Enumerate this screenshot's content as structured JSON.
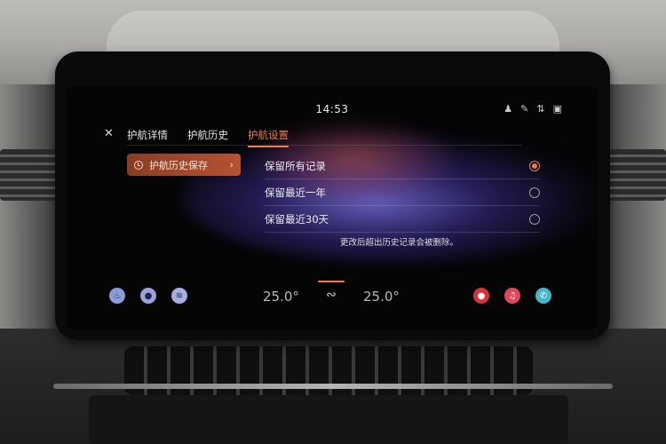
{
  "status_bar": {
    "time": "14:53",
    "icons": [
      "person-icon",
      "pen-icon",
      "bluetooth-icon",
      "signal-icon"
    ]
  },
  "header": {
    "close_icon": "close-icon",
    "tabs": [
      {
        "label": "护航详情"
      },
      {
        "label": "护航历史"
      },
      {
        "label": "护航设置"
      }
    ],
    "active_tab": 2
  },
  "sidebar": {
    "item_label": "护航历史保存"
  },
  "options": [
    {
      "label": "保留所有记录",
      "selected": true
    },
    {
      "label": "保留最近一年",
      "selected": false
    },
    {
      "label": "保留最近30天",
      "selected": false
    }
  ],
  "note": "更改后超出历史记录会被删除。",
  "dock": {
    "left_temp": "25.0°",
    "right_temp": "25.0°",
    "left_buttons": [
      "seat-heat-icon",
      "car-icon",
      "defrost-icon"
    ],
    "right_buttons": [
      "navigation-icon",
      "music-icon",
      "phone-icon"
    ]
  },
  "colors": {
    "accent": "#f07a4a",
    "nav": "#d8333a",
    "music": "#e0475a",
    "phone": "#49b5c9"
  }
}
